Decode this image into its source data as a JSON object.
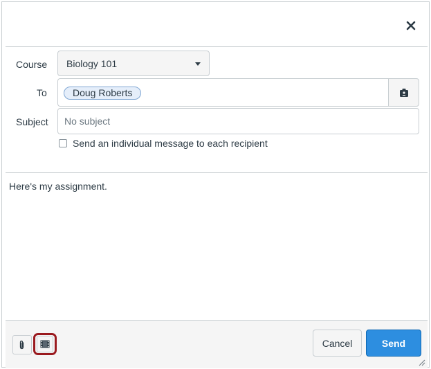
{
  "header": {
    "close_icon": "close-icon"
  },
  "form": {
    "course_label": "Course",
    "course_value": "Biology 101",
    "to_label": "To",
    "recipients": [
      "Doug Roberts"
    ],
    "address_book_icon": "address-book-icon",
    "subject_label": "Subject",
    "subject_value": "",
    "subject_placeholder": "No subject",
    "individual_message_label": "Send an individual message to each recipient",
    "individual_message_checked": false
  },
  "message": {
    "body": "Here's my assignment."
  },
  "footer": {
    "attach_icon": "paperclip-icon",
    "media_icon": "film-icon",
    "cancel_label": "Cancel",
    "send_label": "Send"
  },
  "colors": {
    "primary": "#2d8ee0",
    "highlight": "#9a1a1f",
    "token_bg": "#e5eefa"
  }
}
